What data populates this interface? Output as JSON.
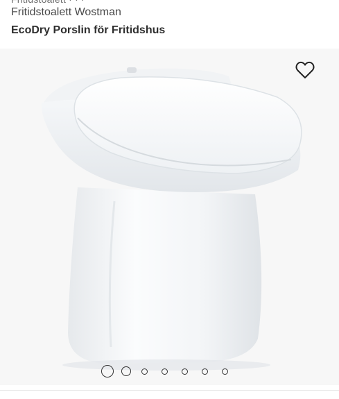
{
  "product": {
    "clipped_text": "Fritidstoalett · ...",
    "subtitle": "Fritidstoalett Wostman",
    "title": "EcoDry Porslin för Fritidshus"
  },
  "gallery": {
    "image_count": 7,
    "active_index": 0,
    "favorite_icon": "heart-outline-icon",
    "colors": {
      "background": "#f7f7f7",
      "dot": "#333333"
    }
  }
}
